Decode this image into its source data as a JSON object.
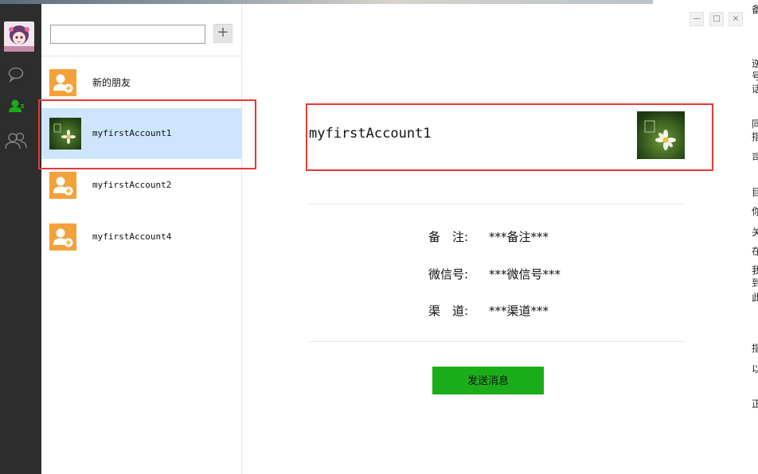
{
  "colors": {
    "rail_bg": "#2d2d2d",
    "accent_green": "#1aad19",
    "selected_bg": "#cde6fd",
    "highlight_red": "#e53935",
    "new_friend_orange": "#f4a13a"
  },
  "rail": {
    "icons": [
      "avatar",
      "chat-bubble-icon",
      "contacts-icon",
      "group-icon"
    ]
  },
  "search": {
    "value": "",
    "add_label": "+"
  },
  "contacts": [
    {
      "label": "新的朋友",
      "icon": "add-friend-icon"
    },
    {
      "label": "myfirstAccount1",
      "icon": "flower-avatar",
      "selected": true
    },
    {
      "label": "myfirstAccount2",
      "icon": "add-friend-icon"
    },
    {
      "label": "myfirstAccount4",
      "icon": "add-friend-icon"
    }
  ],
  "window_controls": {
    "minimize": "—",
    "maximize": "□",
    "close": "×"
  },
  "detail": {
    "name": "myfirstAccount1",
    "fields": [
      {
        "key": "备　注:",
        "value": "***备注***"
      },
      {
        "key": "微信号:",
        "value": "***微信号***"
      },
      {
        "key": "渠　道:",
        "value": "***渠道***"
      }
    ],
    "send_label": "发送消息"
  }
}
